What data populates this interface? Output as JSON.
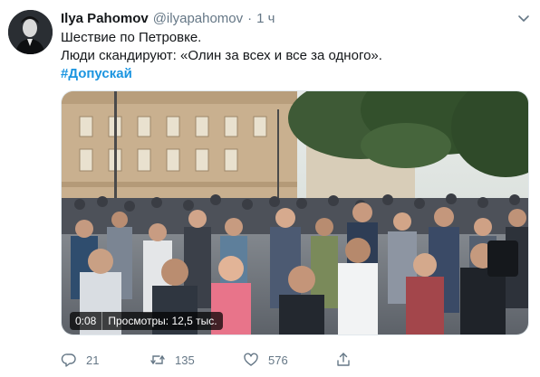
{
  "tweet": {
    "display_name": "Ilya Pahomov",
    "handle": "@ilyapahomov",
    "separator": "·",
    "time": "1 ч",
    "lines": [
      "Шествие по Петровке.",
      "Люди скандируют: «Олин за всех и все за одного»."
    ],
    "hashtag": "#Допускай"
  },
  "video": {
    "duration": "0:08",
    "views": "Просмотры: 12,5 тыс."
  },
  "actions": {
    "reply_count": "21",
    "retweet_count": "135",
    "like_count": "576"
  },
  "icons": {
    "caret": "chevron-down-icon",
    "reply": "reply-icon",
    "retweet": "retweet-icon",
    "like": "heart-icon",
    "share": "share-icon"
  },
  "colors": {
    "text": "#14171a",
    "secondary": "#657786",
    "link": "#1b95e0",
    "border": "#e1e8ed"
  }
}
